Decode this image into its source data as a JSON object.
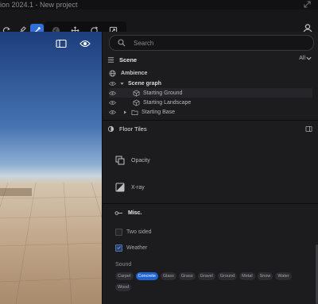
{
  "window": {
    "title": "ion 2024.1 - New project"
  },
  "toolbar": {
    "icons": [
      "refresh-icon",
      "brush-icon",
      "wand-icon",
      "back-icon",
      "move-icon",
      "rotate-icon",
      "scale-icon",
      "user-icon"
    ],
    "active_tool": "wand-icon"
  },
  "colors": {
    "accent": "#1f63d0",
    "panel_bg": "#1c1c1f",
    "sky": "#4673b2",
    "ground": "#c0a589"
  },
  "search": {
    "placeholder": "Search",
    "value": ""
  },
  "scene": {
    "title": "Scene",
    "filter": "All",
    "items": [
      {
        "label": "Ambience",
        "level": 0,
        "icon": "globe-icon"
      },
      {
        "label": "Scene graph",
        "level": 0,
        "icon": "chevron-down-icon"
      },
      {
        "label": "Starting Ground",
        "level": 2,
        "icon": "cube-icon"
      },
      {
        "label": "Starting Landscape",
        "level": 2,
        "icon": "cube-icon"
      },
      {
        "label": "Starting Base",
        "level": 1,
        "icon": "folder-icon"
      }
    ]
  },
  "inspector": {
    "title": "Floor Tiles",
    "opacity_label": "Opacity",
    "xray_label": "X-ray",
    "misc_label": "Misc.",
    "two_sided": {
      "label": "Two sided",
      "checked": false
    },
    "weather": {
      "label": "Weather",
      "checked": true
    },
    "sound_label": "Sound",
    "sound_options": [
      "Carpet",
      "Concrete",
      "Glass",
      "Grass",
      "Gravel",
      "Ground",
      "Metal",
      "Snow",
      "Water",
      "Wood"
    ],
    "sound_selected": "Concrete"
  }
}
